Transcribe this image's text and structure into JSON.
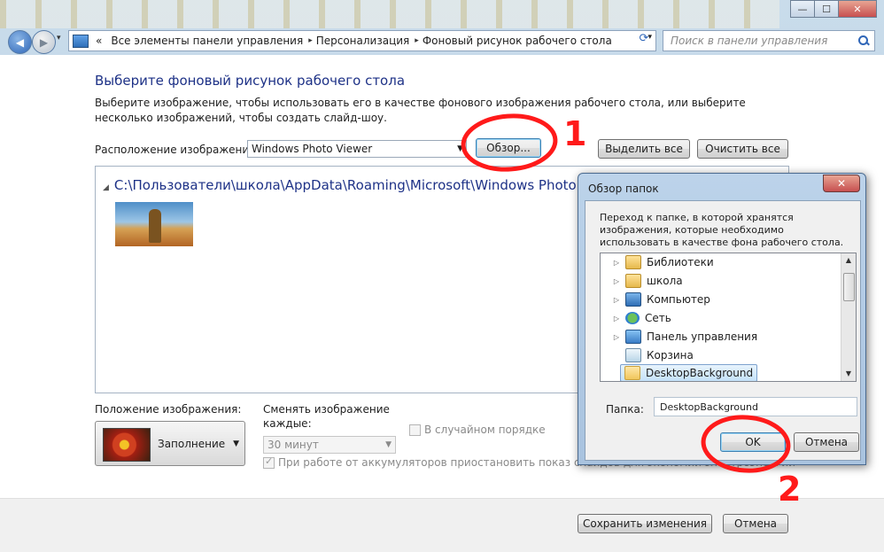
{
  "window": {
    "controls": {
      "minimize": "—",
      "maximize": "☐",
      "close": "✕"
    }
  },
  "nav": {
    "back_icon": "◀",
    "forward_icon": "▶",
    "history_drop": "▾",
    "breadcrumb": [
      "Все элементы панели управления",
      "Персонализация",
      "Фоновый рисунок рабочего стола"
    ],
    "overflow": "«",
    "separator": "▸",
    "address_drop": "▾",
    "refresh_icon": "⟳",
    "search_placeholder": "Поиск в панели управления"
  },
  "main": {
    "heading": "Выберите фоновый рисунок рабочего стола",
    "description": "Выберите изображение, чтобы использовать его в качестве фонового изображения рабочего стола, или выберите несколько изображений, чтобы создать слайд-шоу.",
    "location_label": "Расположение изображения:",
    "location_value": "Windows Photo Viewer",
    "browse_button": "Обзор...",
    "select_all_button": "Выделить все",
    "clear_all_button": "Очистить все",
    "folder_path": "C:\\Пользователи\\школа\\AppData\\Roaming\\Microsoft\\Windows Photo Viewer",
    "position_label": "Положение изображения:",
    "position_value": "Заполнение",
    "change_label": "Сменять изображение каждые:",
    "interval_value": "30 минут",
    "shuffle_label": "В случайном порядке",
    "battery_label": "При работе от аккумуляторов приостановить показ слайдов для экономии электроэнергии",
    "save_button": "Сохранить изменения",
    "cancel_button": "Отмена"
  },
  "dialog": {
    "title": "Обзор папок",
    "close": "✕",
    "description": "Переход к папке, в которой хранятся изображения, которые необходимо использовать в качестве фона рабочего стола.",
    "tree": [
      {
        "label": "Библиотеки",
        "expandable": true,
        "icon": "library-icon"
      },
      {
        "label": "школа",
        "expandable": true,
        "icon": "user-folder-icon"
      },
      {
        "label": "Компьютер",
        "expandable": true,
        "icon": "computer-icon"
      },
      {
        "label": "Сеть",
        "expandable": true,
        "icon": "network-icon"
      },
      {
        "label": "Панель управления",
        "expandable": true,
        "icon": "control-panel-icon"
      },
      {
        "label": "Корзина",
        "expandable": false,
        "icon": "recycle-bin-icon"
      },
      {
        "label": "DesktopBackground",
        "expandable": false,
        "icon": "folder-icon",
        "selected": true
      }
    ],
    "folder_label": "Папка:",
    "folder_value": "DesktopBackground",
    "ok_button": "OK",
    "cancel_button": "Отмена"
  },
  "annotations": {
    "marker_1": "1",
    "marker_2": "2",
    "color": "#ff1a1a"
  }
}
